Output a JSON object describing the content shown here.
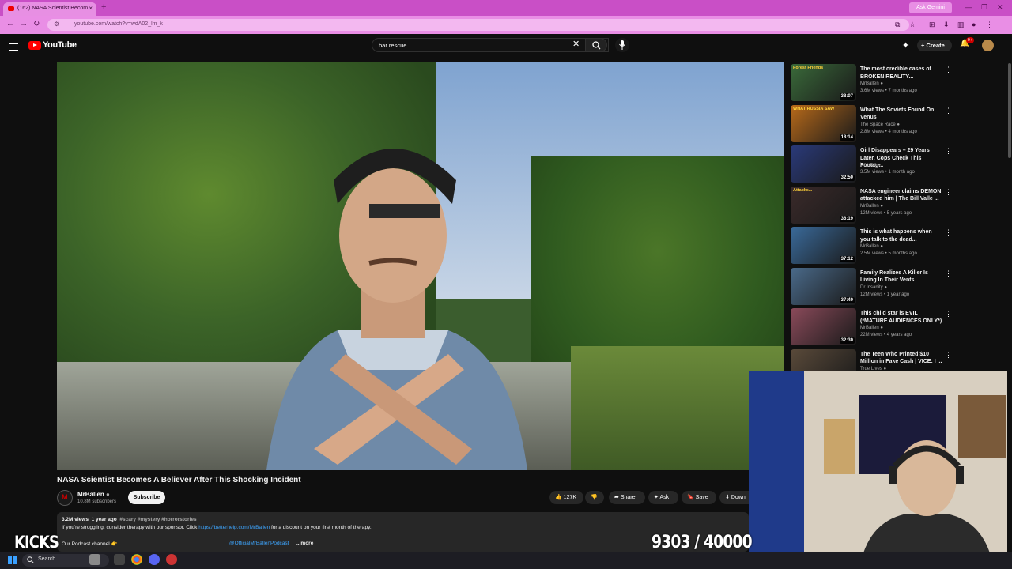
{
  "browser": {
    "tab_title": "(162) NASA Scientist Becom...",
    "url": "youtube.com/watch?v=wdA02_lm_k",
    "ask_gemini": "Ask Gemini",
    "accent": "#c94fc6"
  },
  "header": {
    "logo_text": "YouTube",
    "search_value": "bar rescue",
    "create_label": "Create",
    "notif_count": "9+"
  },
  "video": {
    "title": "NASA Scientist Becomes A Believer After This Shocking Incident",
    "channel": "MrBallen",
    "subscribers": "10.8M subscribers",
    "subscribe_label": "Subscribe",
    "likes": "127K",
    "share_label": "Share",
    "ask_label": "Ask",
    "save_label": "Save",
    "download_label": "Down",
    "views": "3.2M views",
    "age": "1 year ago",
    "tags": "#scary #mystery #horrorstories",
    "desc_line1": "If you're struggling, consider therapy with our sponsor. Click",
    "desc_link": "https://betterhelp.com/MrBallen",
    "desc_line1_end": "for a discount on your first month of therapy.",
    "desc_line2": "Our Podcast channel 👉",
    "desc_podcast": "@OfficialMrBallenPodcast",
    "more_label": "...more"
  },
  "recommendations": [
    {
      "title": "The most credible cases of BROKEN REALITY...",
      "channel": "MrBallen",
      "meta": "3.6M views • 7 months ago",
      "duration": "38:07",
      "thumb_text": "Forest Friends",
      "color": "#3a6a3a"
    },
    {
      "title": "What The Soviets Found On Venus",
      "channel": "The Space Race",
      "meta": "2.8M views • 4 months ago",
      "duration": "18:14",
      "thumb_text": "WHAT RUSSIA SAW",
      "color": "#b86a1a"
    },
    {
      "title": "Girl Disappears – 29 Years Later, Cops Check This Footag...",
      "channel": "Unseen",
      "meta": "3.5M views • 1 month ago",
      "duration": "32:50",
      "thumb_text": "",
      "color": "#2a3a7a"
    },
    {
      "title": "NASA engineer claims DEMON attacked him | The Bill Valle ...",
      "channel": "MrBallen",
      "meta": "12M views • 5 years ago",
      "duration": "36:19",
      "thumb_text": "Attacks...",
      "color": "#3a2a2a"
    },
    {
      "title": "This is what happens when you talk to the dead...",
      "channel": "MrBallen",
      "meta": "2.5M views • 5 months ago",
      "duration": "37:12",
      "thumb_text": "",
      "color": "#3a6a9a"
    },
    {
      "title": "Family Realizes A Killer Is Living In Their Vents",
      "channel": "Dr Insanity",
      "meta": "12M views • 1 year ago",
      "duration": "37:40",
      "thumb_text": "",
      "color": "#4a6a8a"
    },
    {
      "title": "This child star is EVIL (*MATURE AUDIENCES ONLY*)",
      "channel": "MrBallen",
      "meta": "22M views • 4 years ago",
      "duration": "32:30",
      "thumb_text": "",
      "color": "#8a4a5a"
    },
    {
      "title": "The Teen Who Printed $10 Million in Fake Cash | VICE: I ...",
      "channel": "True Lives",
      "meta": "",
      "duration": "",
      "thumb_text": "",
      "color": "#5a4a3a"
    }
  ],
  "overlay": {
    "left_text": "KICKS",
    "counter": "9303 / 40000"
  },
  "taskbar": {
    "search_label": "Search"
  }
}
